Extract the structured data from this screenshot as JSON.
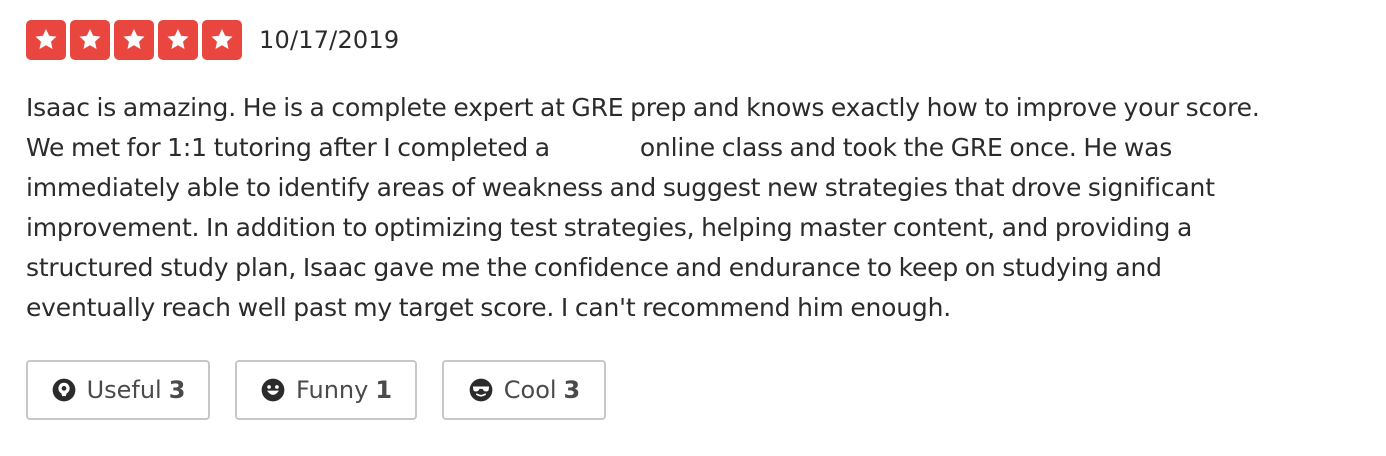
{
  "rating": {
    "value": 5,
    "max": 5,
    "star_color": "#e8463f",
    "icon": "star-icon"
  },
  "date": "10/17/2019",
  "review_lines": [
    "Isaac is amazing. He is a complete expert at GRE prep and knows exactly how to improve your score.",
    "We met for 1:1 tutoring after I completed a",
    "online class and took the GRE once. He was",
    "immediately able to identify areas of weakness and suggest new strategies that drove significant",
    "improvement. In addition to optimizing test strategies, helping master content, and providing a",
    "structured study plan, Isaac gave me the confidence and endurance to keep on studying and",
    "eventually reach well past my target score. I can't recommend him enough."
  ],
  "actions": {
    "useful": {
      "label": "Useful",
      "count": "3",
      "icon": "lightbulb-icon"
    },
    "funny": {
      "label": "Funny",
      "count": "1",
      "icon": "smiley-icon"
    },
    "cool": {
      "label": "Cool",
      "count": "3",
      "icon": "sunglasses-icon"
    }
  }
}
